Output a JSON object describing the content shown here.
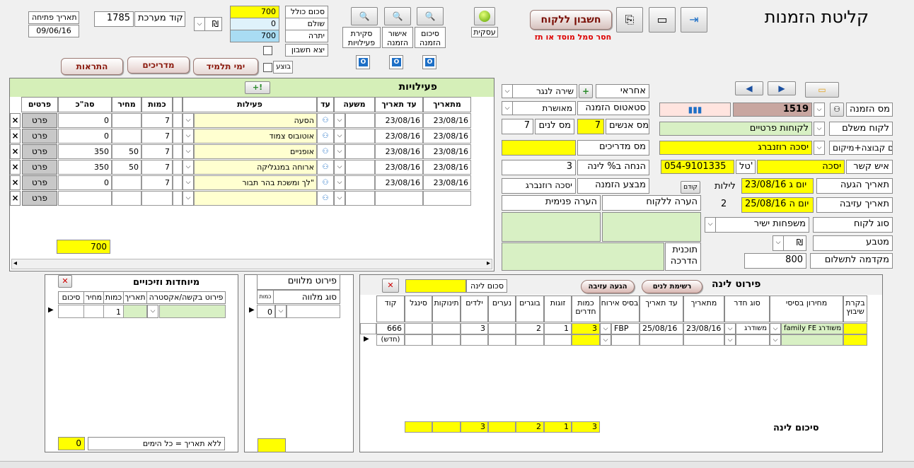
{
  "app": {
    "title": "קליטת הזמנות"
  },
  "toolbar": {
    "account_button": "חשבון ללקוח",
    "account_warning": "חסר סמל מוסד או תז",
    "business_label": "עסקית",
    "summary_label": "סיכום הזמנה",
    "approve_label": "אישור הזמנה",
    "activities_review_label": "סקירת פעילויות"
  },
  "totals": {
    "total_label": "סכום כולל",
    "total_value": "700",
    "paid_label": "שולם",
    "paid_value": "0",
    "balance_label": "יתרה",
    "balance_value": "700",
    "issued_label": "יצא חשבון",
    "done_label": "בוצע"
  },
  "system": {
    "code_label": "קוד מערכת",
    "code_value": "1785",
    "currency": "₪",
    "open_date_label": "תאריך פתיחה",
    "open_date": "09/06/16"
  },
  "tabs": {
    "alerts": "התראות",
    "guides": "מדריכים",
    "student_days": "ימי תלמיד"
  },
  "order": {
    "number_label": "מס הזמנה",
    "number": "1519",
    "payer_label": "לקוח משלם",
    "payer": "לקוחות פרטיים",
    "group_label": "שם קבוצה+מיקום",
    "group": "יסכה רוזנברג",
    "contact_label": "איש קשר",
    "contact": "יסכה",
    "phone_label": "טל'",
    "phone": "054-9101335",
    "arrival_label": "תאריך הגעה",
    "arrival": "23/08/16 יום ג",
    "nights_label": "לילות",
    "nights": "2",
    "departure_label": "תאריך עזיבה",
    "departure": "25/08/16 יום ה",
    "customer_type_label": "סוג לקוח",
    "customer_type": "משפחות ישיר",
    "currency_label": "מטבע",
    "currency": "₪",
    "advance_label": "מקדמה לתשלום",
    "advance": "800",
    "prev_label": "קודם"
  },
  "mid": {
    "responsible_label": "אחראי",
    "responsible": "שירה לנגר",
    "status_label": "סטאטוס הזמנה",
    "status": "מאושרת",
    "people_label": "מס אנשים",
    "people": "7",
    "sleepers_label": "מס לנים",
    "sleepers": "7",
    "guides_label": "מס מדריכים",
    "guides": "",
    "discount_label": "הנחה ב% לינה",
    "discount": "3",
    "executor_label": "מבצע הזמנה",
    "executor": "יסכה רוזנברג",
    "cust_note_label": "הערה ללקוח",
    "internal_note_label": "הערה פנימית",
    "guide_plan_label": "תוכנית הדרכה"
  },
  "activities": {
    "title": "פעילויות",
    "total": "700",
    "headers": {
      "from": "מתאריך",
      "to": "עד תאריך",
      "shift": "משעה",
      "hour": "עד",
      "activity": "פעילות",
      "qty": "כמות",
      "price": "מחיר",
      "sum": "סה\"כ",
      "details": "פרטים"
    },
    "detail_btn": "פרט",
    "rows": [
      {
        "from": "23/08/16",
        "to": "23/08/16",
        "activity": "הסעה",
        "qty": "7",
        "price": "",
        "sum": "0"
      },
      {
        "from": "23/08/16",
        "to": "23/08/16",
        "activity": "אוטובוס צמוד",
        "qty": "7",
        "price": "",
        "sum": "0"
      },
      {
        "from": "23/08/16",
        "to": "23/08/16",
        "activity": "אופניים",
        "qty": "7",
        "price": "50",
        "sum": "350"
      },
      {
        "from": "23/08/16",
        "to": "23/08/16",
        "activity": "ארוחה במנגליקה",
        "qty": "7",
        "price": "50",
        "sum": "350"
      },
      {
        "from": "23/08/16",
        "to": "23/08/16",
        "activity": "\"לך ומשכת בהר תבור",
        "qty": "7",
        "price": "",
        "sum": "0"
      },
      {
        "from": "",
        "to": "",
        "activity": "",
        "qty": "",
        "price": "",
        "sum": ""
      }
    ]
  },
  "extras": {
    "title": "מיוחדות וזיכויים",
    "headers": {
      "detail": "פירוט בקשה/אקסטרה",
      "date": "תאריך",
      "qty": "כמות",
      "price": "מחיר",
      "sum": "סיכום"
    },
    "qty": "1",
    "no_date_label": "ללא תאריך = כל הימים",
    "total": "0"
  },
  "companions": {
    "title": "פירוט מלווים",
    "type_label": "סוג מלווה",
    "qty_label": "כמות",
    "qty": "0"
  },
  "lodging": {
    "title": "פירוט לינה",
    "summary_title": "סיכום לינה",
    "sum_label": "סכום לינה",
    "rooms_list_btn": "רשימת לנים",
    "arrival_btn": "הגעה עזיבה",
    "headers": {
      "check": "בקרת שיבוץ",
      "pricelist": "מחירון בסיסי",
      "room": "סוג חדר",
      "from": "מתאריך",
      "to": "עד תאריך",
      "board": "בסיס אירוח",
      "rooms": "כמות חדרים",
      "couples": "זוגות",
      "adults": "בוגרים",
      "teens": "נערים",
      "kids": "ילדים",
      "babies": "תינוקות",
      "signal": "סינגל",
      "code": "קוד"
    },
    "row": {
      "pricelist": "family FE משודרג",
      "room": "משודרג",
      "from": "23/08/16",
      "to": "25/08/16",
      "board": "FBP",
      "rooms": "3",
      "couples": "1",
      "adults": "2",
      "teens": "",
      "kids": "3",
      "babies": "",
      "signal": "",
      "code": "666"
    },
    "new_label": "(חדש)",
    "totals": {
      "rooms": "3",
      "couples": "1",
      "adults": "2",
      "teens": "",
      "kids": "3",
      "babies": "",
      "signal": ""
    }
  },
  "colors": {
    "yellow": "#ffff00",
    "green": "#d8f0c4",
    "header_green": "#d5efb8"
  }
}
